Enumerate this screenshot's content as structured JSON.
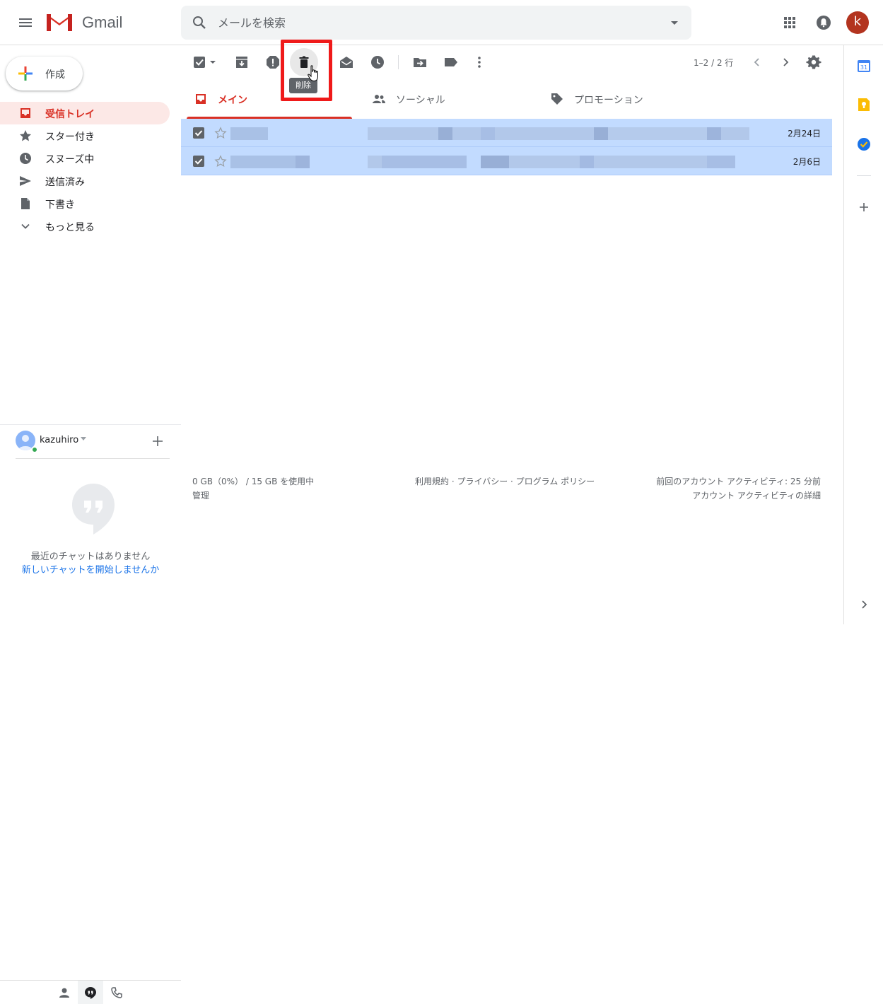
{
  "app": {
    "name": "Gmail"
  },
  "search": {
    "placeholder": "メールを検索"
  },
  "account": {
    "initial": "k"
  },
  "compose": {
    "label": "作成"
  },
  "nav": [
    {
      "label": "受信トレイ",
      "icon": "inbox-icon",
      "active": true
    },
    {
      "label": "スター付き",
      "icon": "star-icon"
    },
    {
      "label": "スヌーズ中",
      "icon": "clock-icon"
    },
    {
      "label": "送信済み",
      "icon": "send-icon"
    },
    {
      "label": "下書き",
      "icon": "draft-icon"
    },
    {
      "label": "もっと見る",
      "icon": "chevron-down-icon"
    }
  ],
  "toolbar": {
    "tooltip": "削除",
    "page_count": "1–2 / 2 行"
  },
  "tabs": [
    {
      "label": "メイン",
      "icon": "inbox-icon",
      "active": true
    },
    {
      "label": "ソーシャル",
      "icon": "people-icon"
    },
    {
      "label": "プロモーション",
      "icon": "tag-icon"
    }
  ],
  "emails": [
    {
      "date": "2月24日",
      "selected": true
    },
    {
      "date": "2月6日",
      "selected": true
    }
  ],
  "footer": {
    "storage": "0 GB（0%） / 15 GB を使用中",
    "manage": "管理",
    "terms": "利用規約 · プライバシー · プログラム ポリシー",
    "last_activity": "前回のアカウント アクティビティ: 25 分前",
    "activity_details": "アカウント アクティビティの詳細"
  },
  "hangouts": {
    "user": "kazuhiro",
    "empty": "最近のチャットはありません",
    "start": "新しいチャットを開始しませんか"
  },
  "rail": {
    "calendar_day": "31"
  },
  "colors": {
    "accent": "#d93025",
    "selected_row": "#c2dbff",
    "highlight_box": "#ef1a1a",
    "avatar": "#b3341f"
  }
}
